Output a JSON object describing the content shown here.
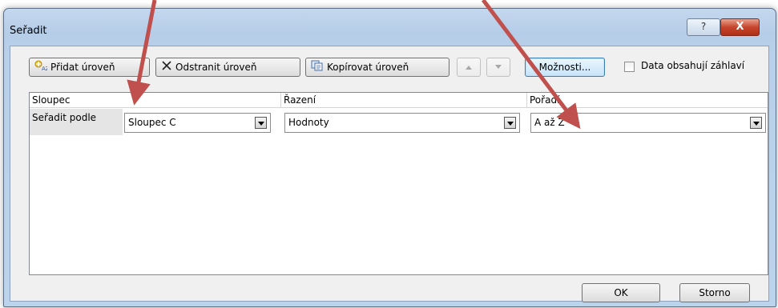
{
  "window": {
    "title": "Seřadit",
    "help_label": "?",
    "close_label": "X"
  },
  "toolbar": {
    "add_level": "Přidat úroveň",
    "delete_level": "Odstranit úroveň",
    "copy_level": "Kopírovat úroveň",
    "options": "Možnosti...",
    "headers_checkbox_label": "Data obsahují záhlaví",
    "headers_checked": false
  },
  "grid": {
    "columns": [
      "Sloupec",
      "Řazení",
      "Pořadí"
    ],
    "rows": [
      {
        "label": "Seřadit podle",
        "column_value": "Sloupec C",
        "sort_on_value": "Hodnoty",
        "order_value": "A až Z"
      }
    ]
  },
  "footer": {
    "ok": "OK",
    "cancel": "Storno"
  },
  "colors": {
    "annotation_arrow": "#c0504d",
    "close_button": "#c7452c",
    "title_bar": "#b9d0ea"
  }
}
